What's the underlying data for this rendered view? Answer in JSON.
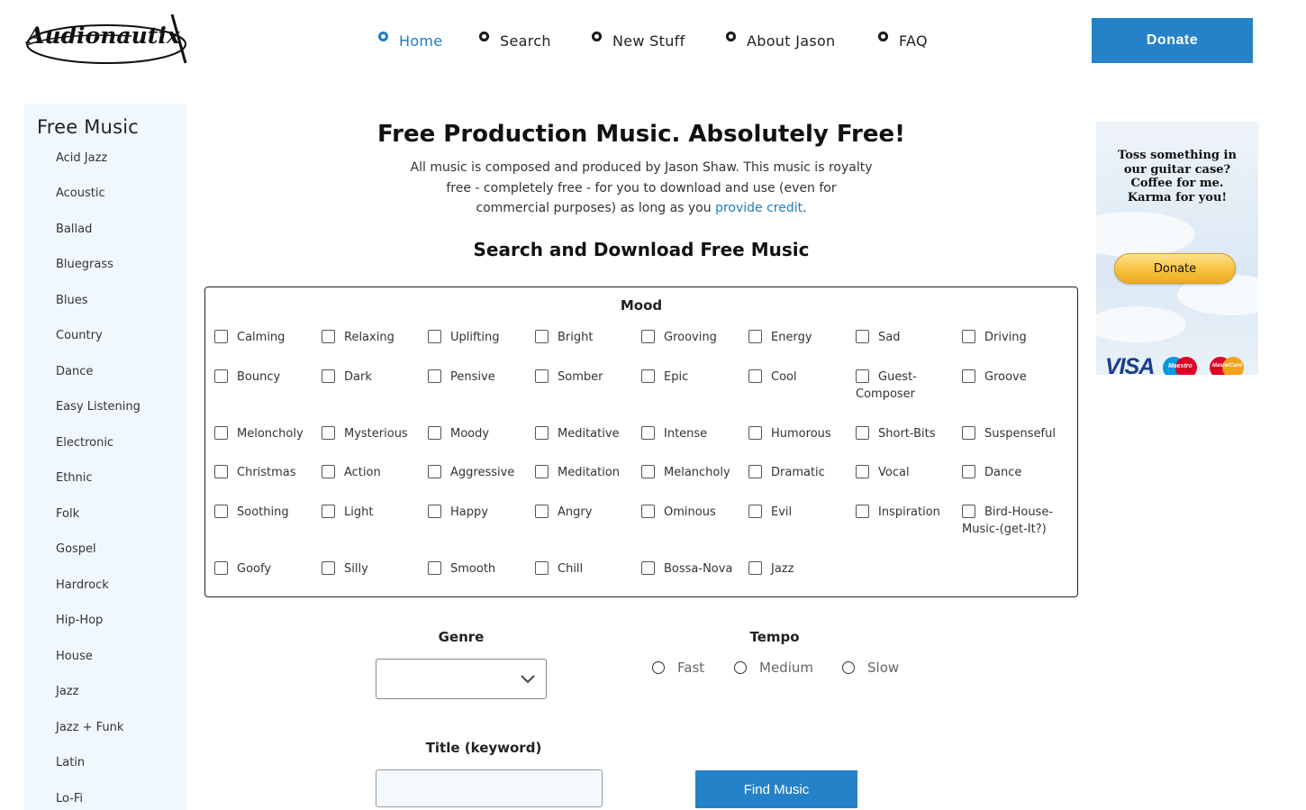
{
  "brand": {
    "name": "Audionautix"
  },
  "nav": {
    "items": [
      {
        "label": "Home",
        "active": true
      },
      {
        "label": "Search",
        "active": false
      },
      {
        "label": "New Stuff",
        "active": false
      },
      {
        "label": "About Jason",
        "active": false
      },
      {
        "label": "FAQ",
        "active": false
      }
    ],
    "donate_label": "Donate"
  },
  "sidebar": {
    "title": "Free Music",
    "items": [
      "Acid Jazz",
      "Acoustic",
      "Ballad",
      "Bluegrass",
      "Blues",
      "Country",
      "Dance",
      "Easy Listening",
      "Electronic",
      "Ethnic",
      "Folk",
      "Gospel",
      "Hardrock",
      "Hip-Hop",
      "House",
      "Jazz",
      "Jazz + Funk",
      "Latin",
      "Lo-Fi"
    ]
  },
  "main": {
    "title": "Free Production Music. Absolutely Free!",
    "intro_text": "All music is composed and produced by Jason Shaw. This music is royalty free - completely free - for you to download and use (even for commercial purposes) as long as you",
    "intro_link": "provide credit",
    "intro_end": ".",
    "search_title": "Search and Download Free Music"
  },
  "mood": {
    "title": "Mood",
    "rows": [
      [
        "Calming",
        "Relaxing",
        "Uplifting",
        "Bright",
        "Grooving",
        "Energy",
        "Sad",
        "Driving"
      ],
      [
        "Bouncy",
        "Dark",
        "Pensive",
        "Somber",
        "Epic",
        "Cool",
        "Guest-Composer",
        "Groove"
      ],
      [
        "Meloncholy",
        "Mysterious",
        "Moody",
        "Meditative",
        "Intense",
        "Humorous",
        "Short-Bits",
        "Suspenseful"
      ],
      [
        "Christmas",
        "Action",
        "Aggressive",
        "Meditation",
        "Melancholy",
        "Dramatic",
        "Vocal",
        "Dance"
      ],
      [
        "Soothing",
        "Light",
        "Happy",
        "Angry",
        "Ominous",
        "Evil",
        "Inspiration",
        "Bird-House-Music-(get-It?)"
      ],
      [
        "Goofy",
        "Silly",
        "Smooth",
        "Chill",
        "Bossa-Nova",
        "Jazz"
      ]
    ]
  },
  "form": {
    "genre_label": "Genre",
    "genre_value": "",
    "tempo_label": "Tempo",
    "tempo_options": [
      "Fast",
      "Medium",
      "Slow"
    ],
    "title_label": "Title (keyword)",
    "title_value": "",
    "find_label": "Find Music"
  },
  "ad": {
    "text": "Toss something in our guitar case? Coffee for me. Karma for you!",
    "donate_label": "Donate",
    "cards": {
      "visa": "VISA",
      "maestro": "Maestro",
      "mastercard": "MasterCard"
    }
  },
  "colors": {
    "accent": "#2682c8",
    "link": "#1f7cc4",
    "sidebar_bg": "#f1f8fd"
  }
}
